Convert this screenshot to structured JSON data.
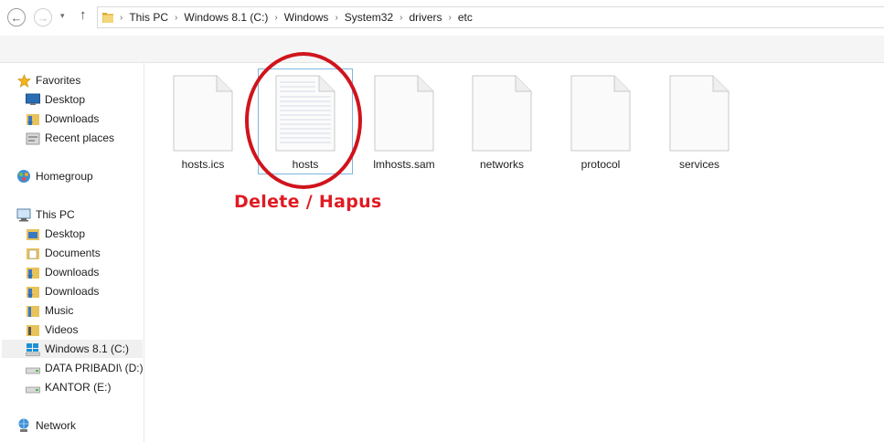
{
  "address": {
    "back_label": "←",
    "forward_label": "→",
    "dropdown_label": "▾",
    "up_label": "↑",
    "crumbs": [
      "This PC",
      "Windows 8.1 (C:)",
      "Windows",
      "System32",
      "drivers",
      "etc"
    ],
    "separator": "›"
  },
  "sidebar": {
    "items": [
      {
        "label": "Favorites",
        "icon": "star-icon"
      },
      {
        "label": "Desktop",
        "icon": "desktop-icon"
      },
      {
        "label": "Downloads",
        "icon": "downloads-folder-icon"
      },
      {
        "label": "Recent places",
        "icon": "recent-places-icon"
      },
      {
        "label": "Homegroup",
        "icon": "homegroup-icon"
      },
      {
        "label": "This PC",
        "icon": "computer-icon"
      },
      {
        "label": "Desktop",
        "icon": "desktop-folder-icon"
      },
      {
        "label": "Documents",
        "icon": "documents-folder-icon"
      },
      {
        "label": "Downloads",
        "icon": "downloads-folder-icon"
      },
      {
        "label": "Downloads",
        "icon": "downloads-folder-icon"
      },
      {
        "label": "Music",
        "icon": "music-folder-icon"
      },
      {
        "label": "Videos",
        "icon": "videos-folder-icon"
      },
      {
        "label": "Windows 8.1 (C:)",
        "icon": "windows-drive-icon"
      },
      {
        "label": "DATA PRIBADI\\ (D:)",
        "icon": "drive-icon"
      },
      {
        "label": "KANTOR (E:)",
        "icon": "drive-icon"
      },
      {
        "label": "Network",
        "icon": "network-icon"
      }
    ]
  },
  "files": [
    {
      "name": "hosts.ics",
      "icon": "file-icon"
    },
    {
      "name": "hosts",
      "icon": "text-file-icon"
    },
    {
      "name": "lmhosts.sam",
      "icon": "file-icon"
    },
    {
      "name": "networks",
      "icon": "file-icon"
    },
    {
      "name": "protocol",
      "icon": "file-icon"
    },
    {
      "name": "services",
      "icon": "file-icon"
    }
  ],
  "annotation": {
    "text": "Delete / Hapus",
    "color": "#e01b22"
  },
  "colors": {
    "selection": "#e5f3fb",
    "selection_border": "#7fb6e0"
  }
}
